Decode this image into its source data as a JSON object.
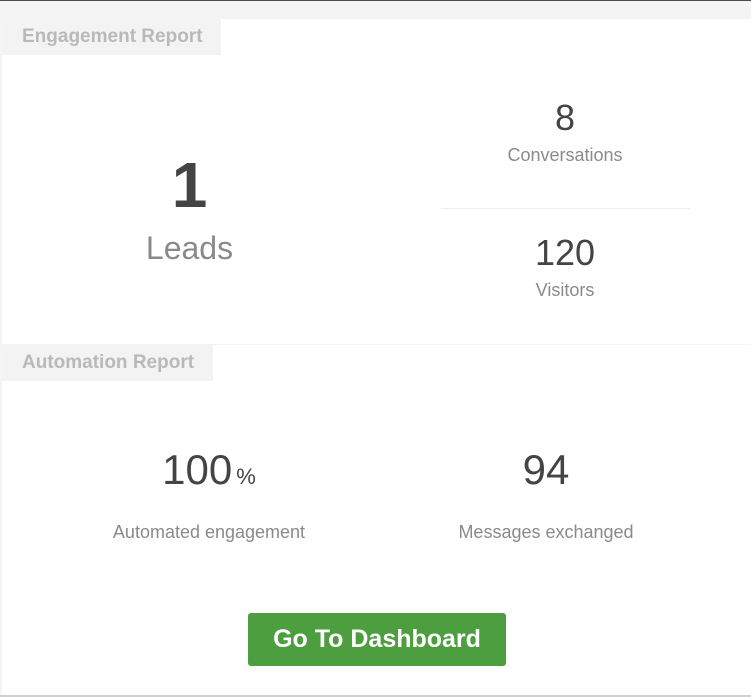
{
  "engagement": {
    "section_title": "Engagement Report",
    "leads": {
      "value": "1",
      "label": "Leads"
    },
    "conversations": {
      "value": "8",
      "label": "Conversations"
    },
    "visitors": {
      "value": "120",
      "label": "Visitors"
    }
  },
  "automation": {
    "section_title": "Automation Report",
    "automated_engagement": {
      "value": "100",
      "unit": "%",
      "label": "Automated engagement"
    },
    "messages_exchanged": {
      "value": "94",
      "label": "Messages exchanged"
    }
  },
  "actions": {
    "dashboard_label": "Go To Dashboard"
  },
  "colors": {
    "button_bg": "#4d9e3f",
    "value_text": "#444444",
    "label_text": "#8a8a8a",
    "tab_text": "#b9b9b9"
  }
}
